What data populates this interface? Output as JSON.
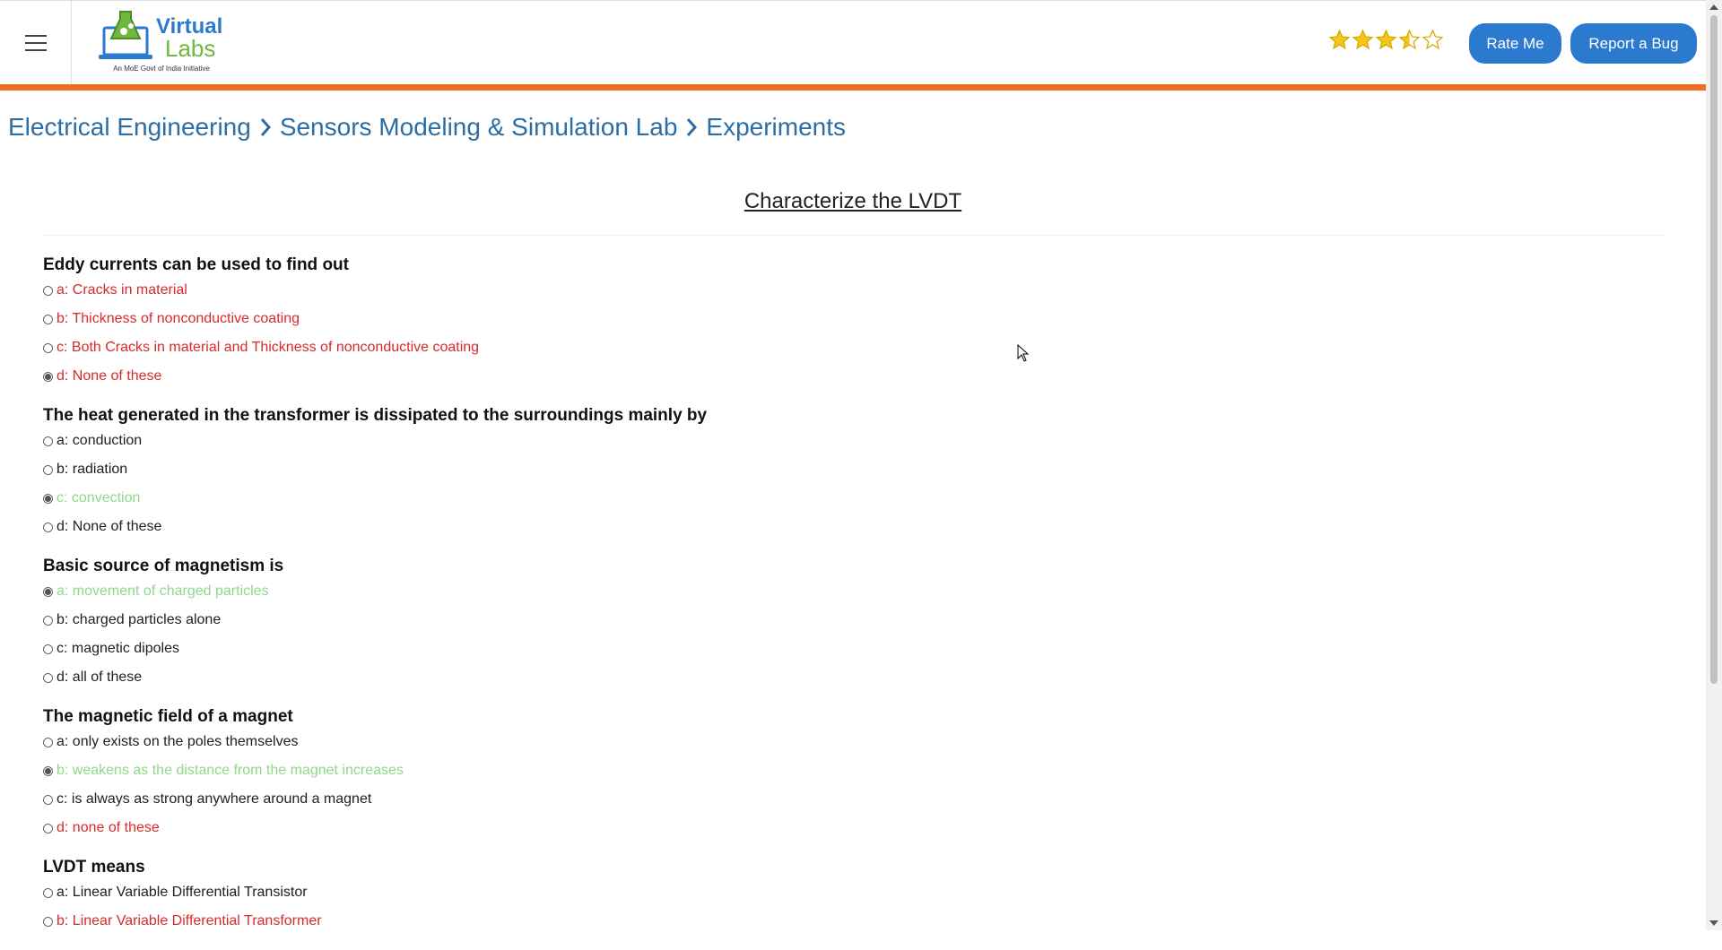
{
  "header": {
    "logo_line1": "Virtual",
    "logo_line2": "Labs",
    "logo_tagline": "An MoE Govt of India Initiative",
    "rating": 3.5,
    "rating_max": 5,
    "rate_button": "Rate Me",
    "bug_button": "Report a Bug",
    "accent_color": "#f26c21",
    "button_color": "#2b7ad0"
  },
  "breadcrumb": [
    "Electrical Engineering",
    "Sensors Modeling & Simulation Lab",
    "Experiments"
  ],
  "page_title": "Characterize the LVDT",
  "questions": [
    {
      "text": "Eddy currents can be used to find out",
      "options": [
        {
          "label": "a: Cracks in material",
          "checked": false,
          "state": "red"
        },
        {
          "label": "b: Thickness of nonconductive coating",
          "checked": false,
          "state": "red"
        },
        {
          "label": "c: Both Cracks in material and Thickness of nonconductive coating",
          "checked": false,
          "state": "red"
        },
        {
          "label": "d: None of these",
          "checked": true,
          "state": "red"
        }
      ]
    },
    {
      "text": "The heat generated in the transformer is dissipated to the surroundings mainly by",
      "options": [
        {
          "label": "a: conduction",
          "checked": false,
          "state": "normal"
        },
        {
          "label": "b: radiation",
          "checked": false,
          "state": "normal"
        },
        {
          "label": "c: convection",
          "checked": true,
          "state": "green"
        },
        {
          "label": "d: None of these",
          "checked": false,
          "state": "normal"
        }
      ]
    },
    {
      "text": "Basic source of magnetism is",
      "options": [
        {
          "label": "a: movement of charged particles",
          "checked": true,
          "state": "green"
        },
        {
          "label": "b: charged particles alone",
          "checked": false,
          "state": "normal"
        },
        {
          "label": "c: magnetic dipoles",
          "checked": false,
          "state": "normal"
        },
        {
          "label": "d: all of these",
          "checked": false,
          "state": "normal"
        }
      ]
    },
    {
      "text": "The magnetic field of a magnet",
      "options": [
        {
          "label": "a: only exists on the poles themselves",
          "checked": false,
          "state": "normal"
        },
        {
          "label": "b: weakens as the distance from the magnet increases",
          "checked": true,
          "state": "green"
        },
        {
          "label": "c: is always as strong anywhere around a magnet",
          "checked": false,
          "state": "normal"
        },
        {
          "label": "d: none of these",
          "checked": false,
          "state": "red"
        }
      ]
    },
    {
      "text": "LVDT means",
      "options": [
        {
          "label": "a: Linear Variable Differential Transistor",
          "checked": false,
          "state": "normal"
        },
        {
          "label": "b: Linear Variable Differential Transformer",
          "checked": false,
          "state": "red"
        }
      ]
    }
  ]
}
